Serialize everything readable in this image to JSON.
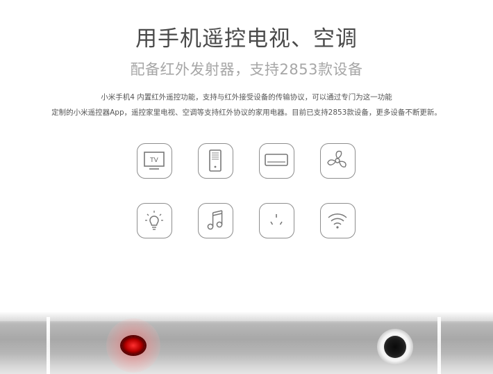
{
  "header": {
    "title": "用手机遥控电视、空调",
    "subtitle": "配备红外发射器，支持2853款设备"
  },
  "description": {
    "line1": "小米手机4 内置红外遥控功能，支持与红外接受设备的传输协议，可以通过专门为这一功能",
    "line2": "定制的小米遥控器App，遥控家里电视、空调等支持红外协议的家用电器。目前已支持2853款设备，更多设备不断更新。"
  },
  "icons": [
    {
      "name": "tv-icon",
      "label": "TV"
    },
    {
      "name": "set-top-box-icon"
    },
    {
      "name": "air-conditioner-icon"
    },
    {
      "name": "fan-icon"
    },
    {
      "name": "light-bulb-icon"
    },
    {
      "name": "music-icon"
    },
    {
      "name": "power-socket-icon"
    },
    {
      "name": "wifi-icon"
    }
  ]
}
